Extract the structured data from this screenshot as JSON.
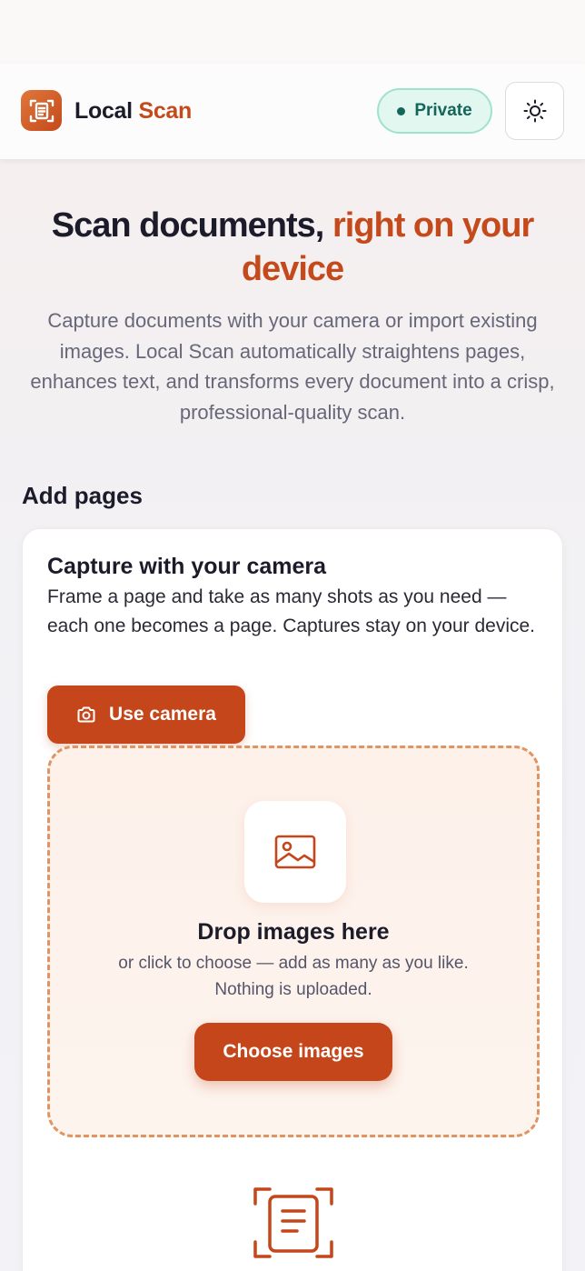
{
  "app": {
    "brand_part1": "Local",
    "brand_part2": "Scan",
    "privacy_badge": "Private",
    "logo_icon": "document-scan-icon",
    "theme_icon": "sun-icon"
  },
  "colors": {
    "accent": "#c4461a",
    "badge_text": "#14665a",
    "badge_bg": "#e3f7f1"
  },
  "hero": {
    "title_dark": "Scan documents,",
    "title_accent": "right on your device",
    "description": "Capture documents with your camera or import existing images. Local Scan automatically straightens pages, enhances text, and transforms every document into a crisp, professional-quality scan."
  },
  "add_pages": {
    "section_title": "Add pages",
    "camera": {
      "title": "Capture with your camera",
      "description": "Frame a page and take as many shots as you need — each one becomes a page. Captures stay on your device.",
      "button_label": "Use camera",
      "button_icon": "camera-icon"
    },
    "dropzone": {
      "icon": "image-icon",
      "title": "Drop images here",
      "description": "or click to choose — add as many as you like. Nothing is uploaded.",
      "button_label": "Choose images"
    },
    "bottom_icon": "document-scan-icon"
  }
}
